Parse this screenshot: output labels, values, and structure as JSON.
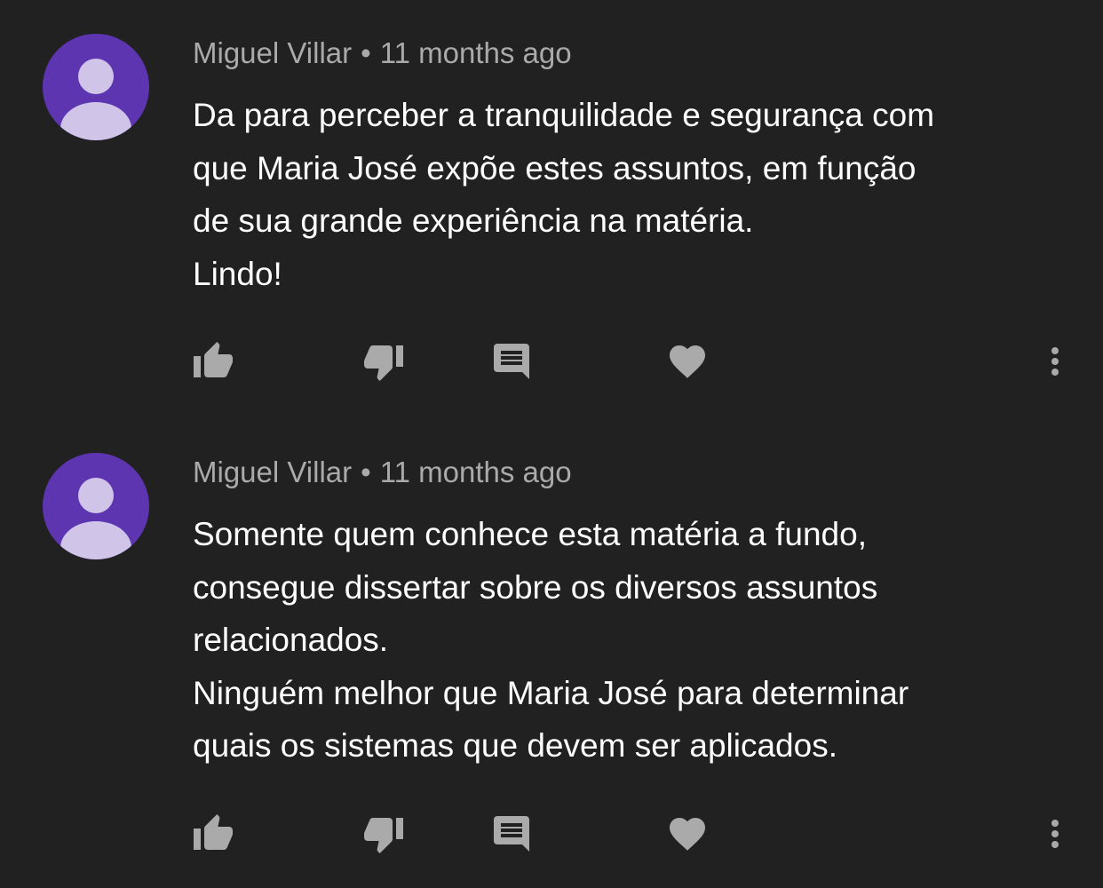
{
  "colors": {
    "background": "#212121",
    "avatar_bg": "#5e35b1",
    "avatar_figure": "#d1c4e9",
    "meta_text": "#aaaaaa",
    "body_text": "#ffffff",
    "icon": "#aaaaaa"
  },
  "comments": [
    {
      "author": "Miguel Villar",
      "separator": "•",
      "time": "11 months ago",
      "lines": [
        "Da para perceber a tranquilidade e segurança com",
        "que Maria José expõe estes assuntos, em função",
        "de sua grande experiência na matéria.",
        "Lindo!"
      ],
      "actions": {
        "like_icon": "thumb-up-icon",
        "dislike_icon": "thumb-down-icon",
        "reply_icon": "comment-icon",
        "heart_icon": "heart-icon",
        "more_icon": "more-vert-icon"
      }
    },
    {
      "author": "Miguel Villar",
      "separator": "•",
      "time": "11 months ago",
      "lines": [
        "Somente quem conhece esta matéria a fundo,",
        "consegue dissertar sobre os diversos assuntos",
        "relacionados.",
        "Ninguém melhor que Maria José para determinar",
        "quais os sistemas que devem ser aplicados."
      ],
      "actions": {
        "like_icon": "thumb-up-icon",
        "dislike_icon": "thumb-down-icon",
        "reply_icon": "comment-icon",
        "heart_icon": "heart-icon",
        "more_icon": "more-vert-icon"
      }
    }
  ]
}
